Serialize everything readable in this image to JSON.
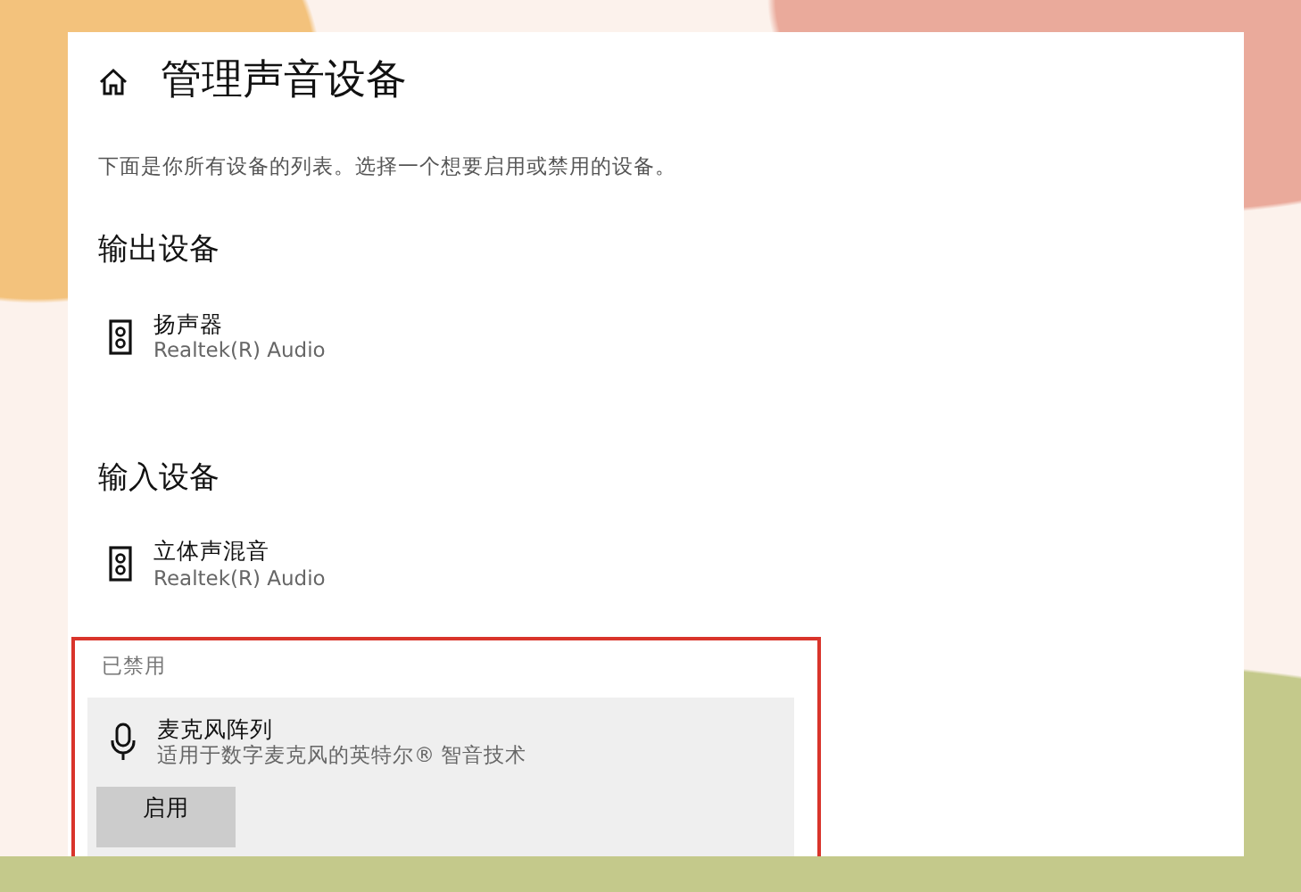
{
  "page": {
    "title": "管理声音设备",
    "description": "下面是你所有设备的列表。选择一个想要启用或禁用的设备。"
  },
  "sections": [
    {
      "heading": "输出设备",
      "devices": [
        {
          "kind": "speaker",
          "name": "扬声器",
          "driver": "Realtek(R) Audio"
        }
      ]
    },
    {
      "heading": "输入设备",
      "devices": [
        {
          "kind": "speaker",
          "name": "立体声混音",
          "driver": "Realtek(R) Audio"
        }
      ]
    }
  ],
  "disabled": {
    "label": "已禁用",
    "highlighted": true,
    "devices": [
      {
        "kind": "microphone",
        "name": "麦克风阵列",
        "driver": "适用于数字麦克风的英特尔® 智音技术",
        "selected": true,
        "button": "启用"
      }
    ]
  }
}
